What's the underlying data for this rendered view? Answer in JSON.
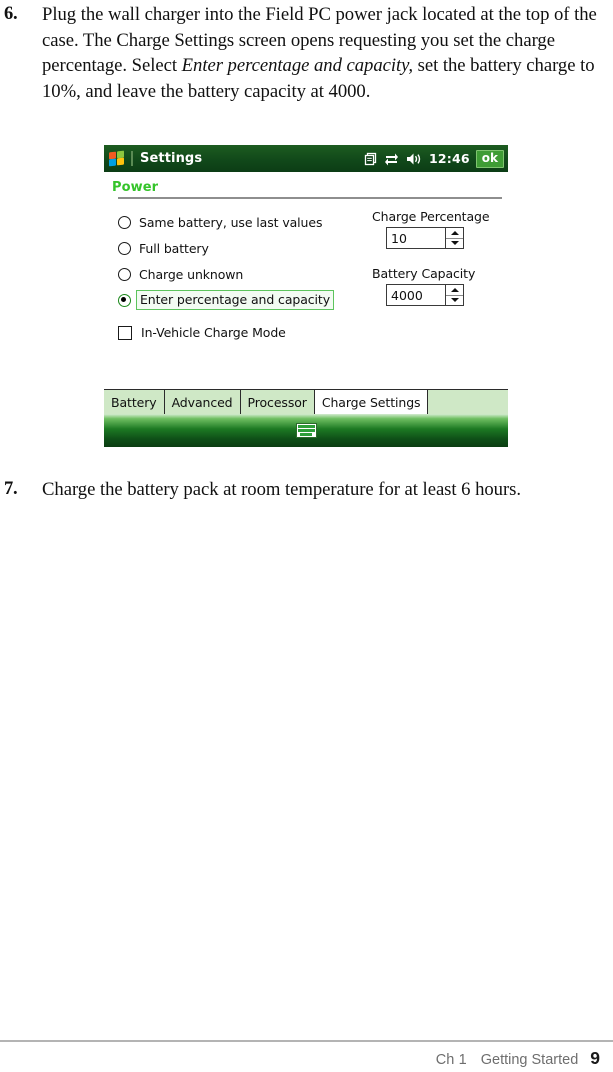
{
  "document": {
    "steps": [
      {
        "number": "6.",
        "text_parts": [
          {
            "style": "normal",
            "text": "Plug the wall charger into the Field PC power jack located at the top of the case. The Charge Settings screen opens requesting you set the charge percentage. Select "
          },
          {
            "style": "italic",
            "text": "Enter percentage and capacity,"
          },
          {
            "style": "normal",
            "text": " set the battery charge to 10%, and leave the battery capacity at 4000."
          }
        ]
      },
      {
        "number": "7.",
        "text_parts": [
          {
            "style": "normal",
            "text": "Charge the battery pack at room temperature for at least 6 hours."
          }
        ]
      }
    ],
    "footer": {
      "chapter": "Ch 1",
      "section": "Getting Started",
      "page_number": "9"
    }
  },
  "device_screenshot": {
    "titlebar": {
      "logo_icon": "windows-flag-icon",
      "title": "Settings",
      "tray_icons": [
        "documents-stack-icon",
        "connectivity-icon",
        "volume-icon"
      ],
      "time": "12:46",
      "ok_button": "ok"
    },
    "page_header": {
      "title": "Power"
    },
    "options": {
      "radios": [
        {
          "label": "Same battery, use last values",
          "selected": false,
          "focused": false
        },
        {
          "label": "Full battery",
          "selected": false,
          "focused": false
        },
        {
          "label": "Charge unknown",
          "selected": false,
          "focused": false
        },
        {
          "label": "Enter percentage and capacity",
          "selected": true,
          "focused": true
        }
      ],
      "checkbox": {
        "label": "In-Vehicle Charge Mode",
        "checked": false
      }
    },
    "spinners": [
      {
        "label": "Charge Percentage",
        "value": "10"
      },
      {
        "label": "Battery Capacity",
        "value": "4000"
      }
    ],
    "tabs": [
      {
        "label": "Battery",
        "active": false
      },
      {
        "label": "Advanced",
        "active": false
      },
      {
        "label": "Processor",
        "active": false
      },
      {
        "label": "Charge Settings",
        "active": true
      }
    ],
    "sip_bar": {
      "icon": "keyboard-icon"
    },
    "colors": {
      "titlebar_green": "#11491a",
      "header_green": "#35c42a",
      "ok_button_green": "#3f9c35",
      "tab_green": "#cfe8c6",
      "focus_green": "#5cc45c"
    }
  }
}
